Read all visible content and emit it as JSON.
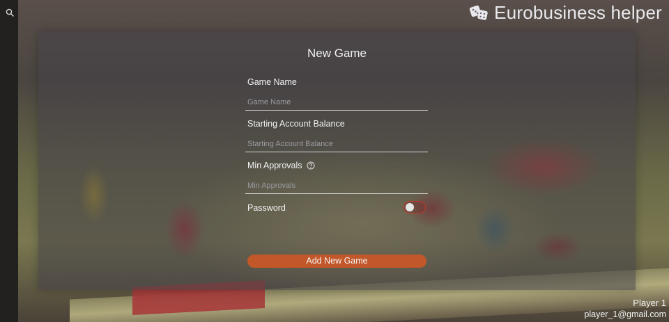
{
  "app": {
    "title": "Eurobusiness helper",
    "brand_icon": "dice-icon"
  },
  "sidebar": {
    "search_icon": "search-icon"
  },
  "dialog": {
    "title": "New Game",
    "fields": [
      {
        "label": "Game Name",
        "placeholder": "Game Name",
        "value": ""
      },
      {
        "label": "Starting Account Balance",
        "placeholder": "Starting Account Balance",
        "value": ""
      },
      {
        "label": "Min Approvals",
        "placeholder": "Min Approvals",
        "value": "",
        "help_icon": "help-circle-icon"
      }
    ],
    "password": {
      "label": "Password",
      "enabled": false,
      "accent": "#c0392b"
    },
    "submit_label": "Add New Game",
    "submit_color": "#c2572a"
  },
  "user": {
    "name": "Player 1",
    "email": "player_1@gmail.com"
  }
}
